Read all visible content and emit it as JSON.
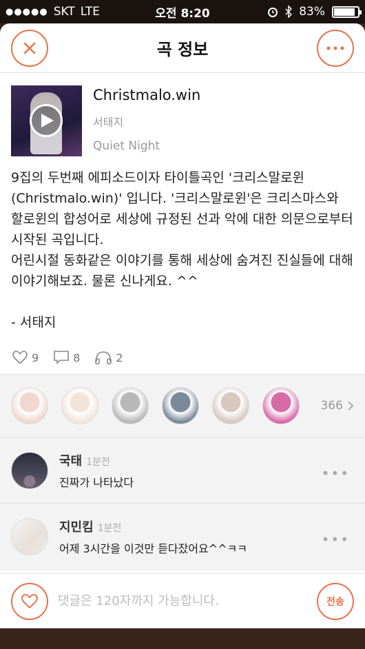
{
  "status_bar": {
    "carrier": "SKT",
    "network": "LTE",
    "time": "오전 8:20",
    "battery": "83%",
    "battery_level": 0.83
  },
  "header": {
    "title": "곡 정보",
    "close_icon": "close-icon",
    "more_icon": "more-icon"
  },
  "song": {
    "title": "Christmalo.win",
    "artist": "서태지",
    "album": "Quiet Night"
  },
  "description": "9집의 두번째 에피소드이자 타이틀곡인 '크리스말로윈(Christmalo.win)' 입니다. '크리스말로윈'은 크리스마스와 할로윈의 합성어로 세상에 규정된 선과 악에 대한 의문으로부터 시작된 곡입니다.\n어린시절 동화같은 이야기를 통해 세상에 숨겨진 진실들에 대해 이야기해보죠. 물론 신나게요. ^^\n\n- 서태지",
  "stats": {
    "likes": "9",
    "comments": "8",
    "listens": "2"
  },
  "listeners": {
    "count": "366",
    "avatar_colors": [
      "#f0d8d0",
      "#f4e4d8",
      "#b8b8b8",
      "#7a8a9a",
      "#d8c8c0",
      "#d86aa8"
    ]
  },
  "comments": [
    {
      "name": "국태",
      "time": "1분전",
      "text": "진짜가 나타났다"
    },
    {
      "name": "지민킴",
      "time": "1분전",
      "text": "어제 3시간을 이것만 듣다잤어요^^ㅋㅋ"
    }
  ],
  "input": {
    "placeholder": "댓글은 120자까지 가능합니다.",
    "send_label": "전송"
  },
  "colors": {
    "accent": "#e8714a"
  }
}
